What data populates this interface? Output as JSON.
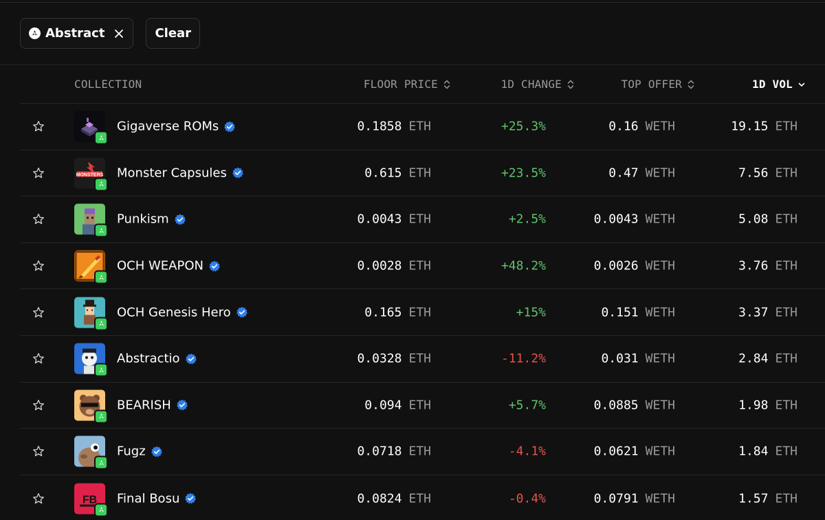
{
  "filters": {
    "chips": [
      {
        "label": "Abstract"
      }
    ],
    "clear_label": "Clear"
  },
  "table": {
    "headers": {
      "collection": "COLLECTION",
      "floor_price": "FLOOR PRICE",
      "change_1d": "1D CHANGE",
      "top_offer": "TOP OFFER",
      "vol_1d": "1D VOL"
    },
    "sorted_by": "1D VOL",
    "rows": [
      {
        "name": "Gigaverse ROMs",
        "floor": "0.1858",
        "floor_unit": "ETH",
        "change": "+25.3%",
        "offer": "0.16",
        "offer_unit": "WETH",
        "vol": "19.15",
        "vol_unit": "ETH"
      },
      {
        "name": "Monster Capsules",
        "floor": "0.615",
        "floor_unit": "ETH",
        "change": "+23.5%",
        "offer": "0.47",
        "offer_unit": "WETH",
        "vol": "7.56",
        "vol_unit": "ETH"
      },
      {
        "name": "Punkism",
        "floor": "0.0043",
        "floor_unit": "ETH",
        "change": "+2.5%",
        "offer": "0.0043",
        "offer_unit": "WETH",
        "vol": "5.08",
        "vol_unit": "ETH"
      },
      {
        "name": "OCH WEAPON",
        "floor": "0.0028",
        "floor_unit": "ETH",
        "change": "+48.2%",
        "offer": "0.0026",
        "offer_unit": "WETH",
        "vol": "3.76",
        "vol_unit": "ETH"
      },
      {
        "name": "OCH Genesis Hero",
        "floor": "0.165",
        "floor_unit": "ETH",
        "change": "+15%",
        "offer": "0.151",
        "offer_unit": "WETH",
        "vol": "3.37",
        "vol_unit": "ETH"
      },
      {
        "name": "Abstractio",
        "floor": "0.0328",
        "floor_unit": "ETH",
        "change": "-11.2%",
        "offer": "0.031",
        "offer_unit": "WETH",
        "vol": "2.84",
        "vol_unit": "ETH"
      },
      {
        "name": "BEARISH",
        "floor": "0.094",
        "floor_unit": "ETH",
        "change": "+5.7%",
        "offer": "0.0885",
        "offer_unit": "WETH",
        "vol": "1.98",
        "vol_unit": "ETH"
      },
      {
        "name": "Fugz",
        "floor": "0.0718",
        "floor_unit": "ETH",
        "change": "-4.1%",
        "offer": "0.0621",
        "offer_unit": "WETH",
        "vol": "1.84",
        "vol_unit": "ETH"
      },
      {
        "name": "Final Bosu",
        "floor": "0.0824",
        "floor_unit": "ETH",
        "change": "-0.4%",
        "offer": "0.0791",
        "offer_unit": "WETH",
        "vol": "1.57",
        "vol_unit": "ETH"
      }
    ]
  },
  "icons": {
    "star": "star-outline-icon",
    "verified": "verified-badge-icon",
    "chain": "abstract-chain-icon",
    "close": "close-icon",
    "sort": "sort-updown-icon",
    "sort_active": "chevron-down-icon"
  },
  "colors": {
    "background": "#111111",
    "positive": "#5ec26a",
    "negative": "#e5534b",
    "verified": "#2f7fe8",
    "chain_badge": "#3ecf5d",
    "muted": "#9a9a9a"
  }
}
